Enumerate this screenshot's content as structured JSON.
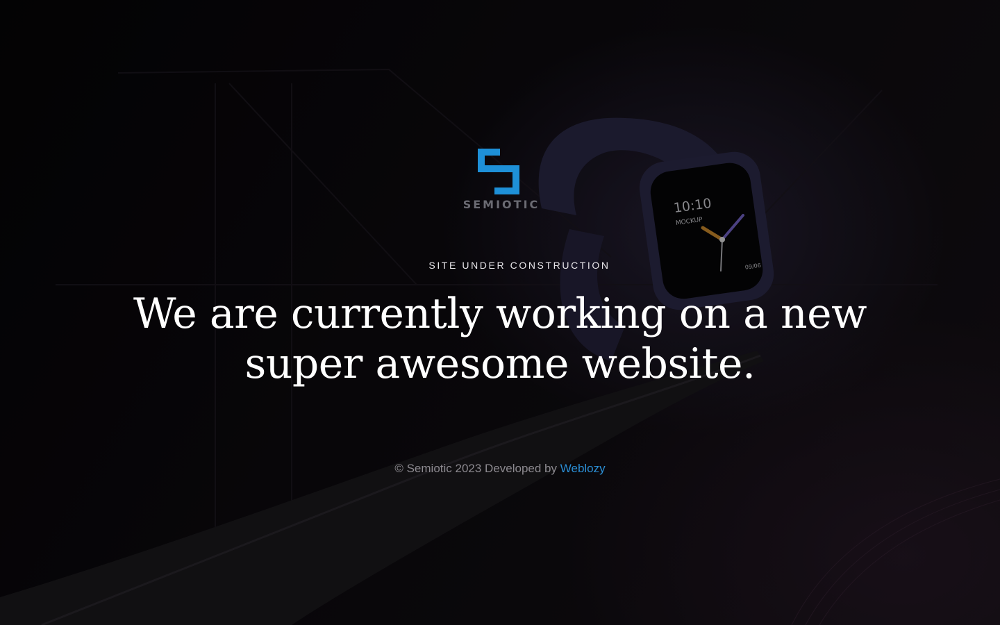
{
  "brand": {
    "name": "SEMIOTIC",
    "accent_color": "#1e90d8",
    "logo_icon": "semiotic-s-logo-icon"
  },
  "hero": {
    "eyebrow": "SITE UNDER CONSTRUCTION",
    "headline": "We are currently working on a new super awesome website."
  },
  "footer": {
    "copyright": "© Semiotic 2023 Developed by",
    "developer_link": "Weblozy",
    "link_color": "#2b8fd6"
  },
  "background": {
    "image": "smartwatch-mockup-photo",
    "watch_face": {
      "time": "10:10",
      "label": "MOCKUP",
      "date": "09/06"
    }
  }
}
